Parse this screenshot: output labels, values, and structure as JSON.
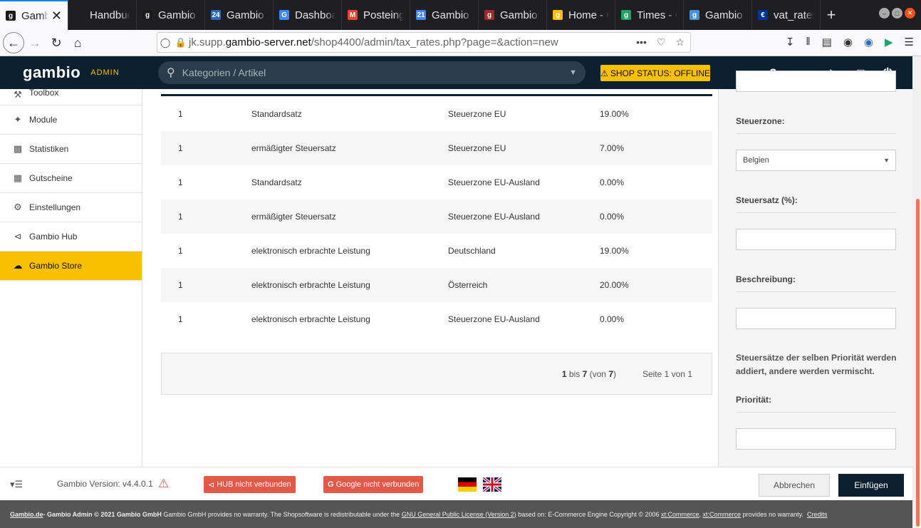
{
  "browser": {
    "tabs": [
      {
        "label": "Gambio",
        "favicon": "g",
        "favicon_color": "#1a1a1a",
        "active": true
      },
      {
        "label": "Handbuch Gambio",
        "favicon": "",
        "favicon_color": "#1f1f23",
        "active": false
      },
      {
        "label": "Gambio",
        "favicon": "g",
        "favicon_color": "#1a1a1a",
        "active": false
      },
      {
        "label": "Gambio",
        "favicon": "24",
        "favicon_color": "#2a6ab5",
        "active": false
      },
      {
        "label": "Dashboard",
        "favicon": "G",
        "favicon_color": "#4285f4",
        "active": false
      },
      {
        "label": "Posteingang",
        "favicon": "M",
        "favicon_color": "#ea4335",
        "active": false
      },
      {
        "label": "Gambio",
        "favicon": "21",
        "favicon_color": "#4285f4",
        "active": false
      },
      {
        "label": "Gambio",
        "favicon": "g",
        "favicon_color": "#9c2b2b",
        "active": false
      },
      {
        "label": "Home - Gambio",
        "favicon": "g",
        "favicon_color": "#f8c000",
        "active": false
      },
      {
        "label": "Times - Gambio",
        "favicon": "g",
        "favicon_color": "#21a366",
        "active": false
      },
      {
        "label": "Gambio",
        "favicon": "g",
        "favicon_color": "#4a90d9",
        "active": false
      },
      {
        "label": "vat_rates",
        "favicon": "€",
        "favicon_color": "#003399",
        "active": false
      }
    ],
    "new_tab": "+",
    "url_prefix": "jk.supp.",
    "url_host": "gambio-server.net",
    "url_path": "/shop4400/admin/tax_rates.php?page=&action=new",
    "url_more": "•••"
  },
  "header": {
    "logo": "gambio",
    "admin": "ADMIN",
    "search_placeholder": "Kategorien / Artikel",
    "shop_status": "SHOP STATUS: OFFLINE"
  },
  "sidebar": {
    "items": [
      {
        "label": "Toolbox",
        "icon": "wrench-icon"
      },
      {
        "label": "Module",
        "icon": "puzzle-icon"
      },
      {
        "label": "Statistiken",
        "icon": "chart-icon"
      },
      {
        "label": "Gutscheine",
        "icon": "gift-icon"
      },
      {
        "label": "Einstellungen",
        "icon": "gears-icon"
      },
      {
        "label": "Gambio Hub",
        "icon": "share-icon"
      },
      {
        "label": "Gambio Store",
        "icon": "cloud-download-icon"
      }
    ]
  },
  "table": {
    "rows": [
      {
        "priority": "1",
        "class": "Standardsatz",
        "zone": "Steuerzone EU",
        "rate": "19.00%"
      },
      {
        "priority": "1",
        "class": "ermäßigter Steuersatz",
        "zone": "Steuerzone EU",
        "rate": "7.00%"
      },
      {
        "priority": "1",
        "class": "Standardsatz",
        "zone": "Steuerzone EU-Ausland",
        "rate": "0.00%"
      },
      {
        "priority": "1",
        "class": "ermäßigter Steuersatz",
        "zone": "Steuerzone EU-Ausland",
        "rate": "0.00%"
      },
      {
        "priority": "1",
        "class": "elektronisch erbrachte Leistung",
        "zone": "Deutschland",
        "rate": "19.00%"
      },
      {
        "priority": "1",
        "class": "elektronisch erbrachte Leistung",
        "zone": "Österreich",
        "rate": "20.00%"
      },
      {
        "priority": "1",
        "class": "elektronisch erbrachte Leistung",
        "zone": "Steuerzone EU-Ausland",
        "rate": "0.00%"
      }
    ],
    "pager": {
      "from": "1",
      "to_label": "bis",
      "to": "7",
      "of_open": "(von",
      "total": "7",
      "of_close": ")",
      "page": "Seite 1 von 1"
    }
  },
  "form": {
    "zone_label": "Steuerzone:",
    "zone_value": "Belgien",
    "rate_label": "Steuersatz (%):",
    "rate_value": "",
    "desc_label": "Beschreibung:",
    "desc_value": "",
    "note": "Steuersätze der selben Priorität werden addiert, andere werden vermischt.",
    "priority_label": "Priorität:",
    "priority_value": ""
  },
  "footer": {
    "version": "Gambio Version: v4.4.0.1",
    "hub": "HUB nicht verbunden",
    "google": "Google nicht verbunden",
    "cancel": "Abbrechen",
    "insert": "Einfügen"
  },
  "copyright": {
    "link1": "Gambio.de",
    "bold1": " - Gambio Admin © 2021 Gambio GmbH",
    "text1": " Gambio GmbH provides no warranty. The Shopsoftware is redistributable under the ",
    "license": "GNU General Public License (Version 2)",
    "text2": " based on: E-Commerce Engine Copyright © 2006 ",
    "xt1": "xt:Commerce",
    "comma": ", ",
    "xt2": "xt:Commerce",
    "text3": " provides no warranty.  ",
    "credits": "Credits"
  },
  "colors": {
    "header_bg": "#0d2031",
    "accent": "#f8c000",
    "danger": "#e25a47"
  }
}
